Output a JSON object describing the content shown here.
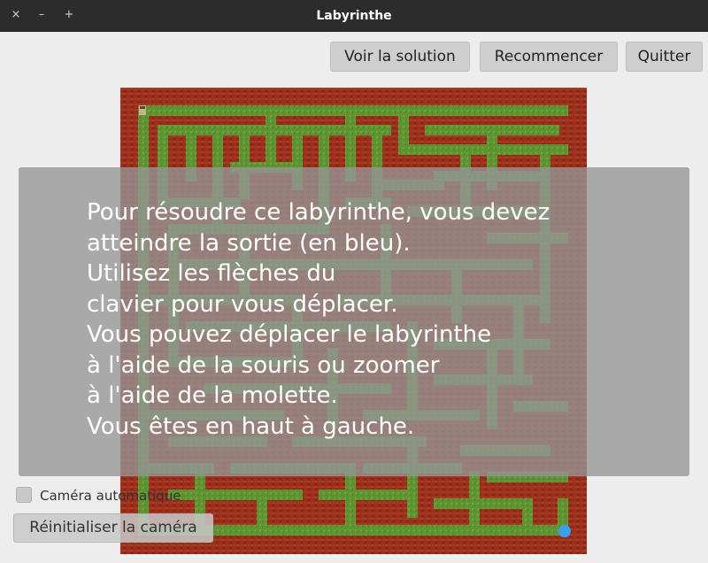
{
  "window": {
    "title": "Labyrinthe",
    "close_glyph": "×",
    "minimize_glyph": "–",
    "maximize_glyph": "+"
  },
  "toolbar": {
    "solution_label": "Voir la solution",
    "restart_label": "Recommencer",
    "quit_label": "Quitter"
  },
  "instructions": {
    "lines": [
      "Pour résoudre ce labyrinthe, vous devez",
      "atteindre la sortie (en bleu).",
      "Utilisez les flèches du",
      "clavier pour vous déplacer.",
      "Vous pouvez déplacer le labyrinthe",
      "à l'aide de la souris ou zoomer",
      "à l'aide de la molette.",
      "Vous êtes en haut à gauche."
    ]
  },
  "camera": {
    "auto_label": "Caméra automatique",
    "auto_checked": false,
    "reset_label": "Réinitialiser la caméra"
  },
  "maze": {
    "wall_color": "#9b2f1c",
    "path_color": "#5e9432",
    "exit_color": "#3aa0f2",
    "player_icon": "player-icon"
  }
}
